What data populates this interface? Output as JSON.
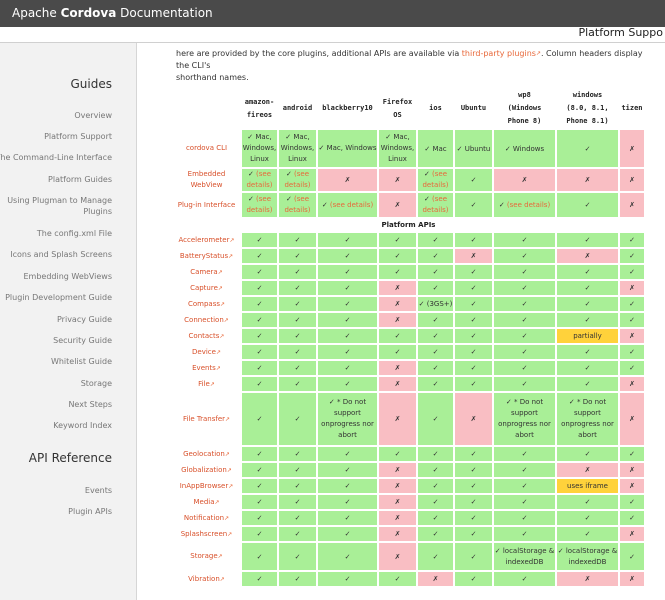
{
  "app": {
    "title_prefix": "Apache ",
    "title_bold": "Cordova",
    "title_suffix": " Documentation",
    "page_title": "Platform Suppo"
  },
  "intro": {
    "pre": "here are provided by the core plugins, additional APIs are available via ",
    "link": "third-party plugins",
    "post": ". Column headers display the CLI's",
    "line2": "shorthand names."
  },
  "sidebar": {
    "guides_heading": "Guides",
    "guides": [
      "Overview",
      "Platform Support",
      "The Command-Line Interface",
      "Platform Guides",
      "Using Plugman to Manage Plugins",
      "The config.xml File",
      "Icons and Splash Screens",
      "Embedding WebViews",
      "Plugin Development Guide",
      "Privacy Guide",
      "Security Guide",
      "Whitelist Guide",
      "Storage",
      "Next Steps",
      "Keyword Index"
    ],
    "api_heading": "API Reference",
    "api": [
      "Events",
      "Plugin APIs"
    ]
  },
  "table": {
    "headers": [
      "amazon-fireos",
      "android",
      "blackberry10",
      "Firefox OS",
      "ios",
      "Ubuntu",
      "wp8 (Windows Phone 8)",
      "windows (8.0, 8.1, Phone 8.1)",
      "tizen"
    ],
    "section_label": "Platform APIs",
    "rows": [
      {
        "label": "cordova CLI",
        "cells": [
          [
            "g",
            "✓ Mac, Windows, Linux"
          ],
          [
            "g",
            "✓ Mac, Windows, Linux"
          ],
          [
            "g",
            "✓ Mac, Windows"
          ],
          [
            "g",
            "✓ Mac, Windows, Linux"
          ],
          [
            "g",
            "✓ Mac"
          ],
          [
            "g",
            "✓ Ubuntu"
          ],
          [
            "g",
            "✓ Windows"
          ],
          [
            "g",
            "✓"
          ],
          [
            "r",
            "✗"
          ]
        ]
      },
      {
        "label": "Embedded WebView",
        "cells": [
          [
            "g",
            "✓ (see details)"
          ],
          [
            "g",
            "✓ (see details)"
          ],
          [
            "r",
            "✗"
          ],
          [
            "r",
            "✗"
          ],
          [
            "g",
            "✓ (see details)"
          ],
          [
            "g",
            "✓"
          ],
          [
            "r",
            "✗"
          ],
          [
            "r",
            "✗"
          ],
          [
            "r",
            "✗"
          ]
        ]
      },
      {
        "label": "Plug-in Interface",
        "cells": [
          [
            "g",
            "✓ (see details)"
          ],
          [
            "g",
            "✓ (see details)"
          ],
          [
            "g",
            "✓ (see details)"
          ],
          [
            "r",
            "✗"
          ],
          [
            "g",
            "✓ (see details)"
          ],
          [
            "g",
            "✓"
          ],
          [
            "g",
            "✓ (see details)"
          ],
          [
            "g",
            "✓"
          ],
          [
            "r",
            "✗"
          ]
        ]
      },
      {
        "label": "Accelerometer",
        "cells": [
          [
            "g",
            "✓"
          ],
          [
            "g",
            "✓"
          ],
          [
            "g",
            "✓"
          ],
          [
            "g",
            "✓"
          ],
          [
            "g",
            "✓"
          ],
          [
            "g",
            "✓"
          ],
          [
            "g",
            "✓"
          ],
          [
            "g",
            "✓"
          ],
          [
            "g",
            "✓"
          ]
        ]
      },
      {
        "label": "BatteryStatus",
        "cells": [
          [
            "g",
            "✓"
          ],
          [
            "g",
            "✓"
          ],
          [
            "g",
            "✓"
          ],
          [
            "g",
            "✓"
          ],
          [
            "g",
            "✓"
          ],
          [
            "r",
            "✗"
          ],
          [
            "g",
            "✓"
          ],
          [
            "r",
            "✗"
          ],
          [
            "g",
            "✓"
          ]
        ]
      },
      {
        "label": "Camera",
        "cells": [
          [
            "g",
            "✓"
          ],
          [
            "g",
            "✓"
          ],
          [
            "g",
            "✓"
          ],
          [
            "g",
            "✓"
          ],
          [
            "g",
            "✓"
          ],
          [
            "g",
            "✓"
          ],
          [
            "g",
            "✓"
          ],
          [
            "g",
            "✓"
          ],
          [
            "g",
            "✓"
          ]
        ]
      },
      {
        "label": "Capture",
        "cells": [
          [
            "g",
            "✓"
          ],
          [
            "g",
            "✓"
          ],
          [
            "g",
            "✓"
          ],
          [
            "r",
            "✗"
          ],
          [
            "g",
            "✓"
          ],
          [
            "g",
            "✓"
          ],
          [
            "g",
            "✓"
          ],
          [
            "g",
            "✓"
          ],
          [
            "r",
            "✗"
          ]
        ]
      },
      {
        "label": "Compass",
        "cells": [
          [
            "g",
            "✓"
          ],
          [
            "g",
            "✓"
          ],
          [
            "g",
            "✓"
          ],
          [
            "r",
            "✗"
          ],
          [
            "g",
            "✓ (3GS+)"
          ],
          [
            "g",
            "✓"
          ],
          [
            "g",
            "✓"
          ],
          [
            "g",
            "✓"
          ],
          [
            "g",
            "✓"
          ]
        ]
      },
      {
        "label": "Connection",
        "cells": [
          [
            "g",
            "✓"
          ],
          [
            "g",
            "✓"
          ],
          [
            "g",
            "✓"
          ],
          [
            "r",
            "✗"
          ],
          [
            "g",
            "✓"
          ],
          [
            "g",
            "✓"
          ],
          [
            "g",
            "✓"
          ],
          [
            "g",
            "✓"
          ],
          [
            "g",
            "✓"
          ]
        ]
      },
      {
        "label": "Contacts",
        "cells": [
          [
            "g",
            "✓"
          ],
          [
            "g",
            "✓"
          ],
          [
            "g",
            "✓"
          ],
          [
            "g",
            "✓"
          ],
          [
            "g",
            "✓"
          ],
          [
            "g",
            "✓"
          ],
          [
            "g",
            "✓"
          ],
          [
            "y",
            "partially"
          ],
          [
            "r",
            "✗"
          ]
        ]
      },
      {
        "label": "Device",
        "cells": [
          [
            "g",
            "✓"
          ],
          [
            "g",
            "✓"
          ],
          [
            "g",
            "✓"
          ],
          [
            "g",
            "✓"
          ],
          [
            "g",
            "✓"
          ],
          [
            "g",
            "✓"
          ],
          [
            "g",
            "✓"
          ],
          [
            "g",
            "✓"
          ],
          [
            "g",
            "✓"
          ]
        ]
      },
      {
        "label": "Events",
        "cells": [
          [
            "g",
            "✓"
          ],
          [
            "g",
            "✓"
          ],
          [
            "g",
            "✓"
          ],
          [
            "r",
            "✗"
          ],
          [
            "g",
            "✓"
          ],
          [
            "g",
            "✓"
          ],
          [
            "g",
            "✓"
          ],
          [
            "g",
            "✓"
          ],
          [
            "g",
            "✓"
          ]
        ]
      },
      {
        "label": "File",
        "cells": [
          [
            "g",
            "✓"
          ],
          [
            "g",
            "✓"
          ],
          [
            "g",
            "✓"
          ],
          [
            "r",
            "✗"
          ],
          [
            "g",
            "✓"
          ],
          [
            "g",
            "✓"
          ],
          [
            "g",
            "✓"
          ],
          [
            "g",
            "✓"
          ],
          [
            "r",
            "✗"
          ]
        ]
      },
      {
        "label": "File Transfer",
        "cells": [
          [
            "g",
            "✓"
          ],
          [
            "g",
            "✓"
          ],
          [
            "g",
            "✓ * Do not support onprogress nor abort"
          ],
          [
            "r",
            "✗"
          ],
          [
            "g",
            "✓"
          ],
          [
            "r",
            "✗"
          ],
          [
            "g",
            "✓ * Do not support onprogress nor abort"
          ],
          [
            "g",
            "✓ * Do not support onprogress nor abort"
          ],
          [
            "r",
            "✗"
          ]
        ]
      },
      {
        "label": "Geolocation",
        "cells": [
          [
            "g",
            "✓"
          ],
          [
            "g",
            "✓"
          ],
          [
            "g",
            "✓"
          ],
          [
            "g",
            "✓"
          ],
          [
            "g",
            "✓"
          ],
          [
            "g",
            "✓"
          ],
          [
            "g",
            "✓"
          ],
          [
            "g",
            "✓"
          ],
          [
            "g",
            "✓"
          ]
        ]
      },
      {
        "label": "Globalization",
        "cells": [
          [
            "g",
            "✓"
          ],
          [
            "g",
            "✓"
          ],
          [
            "g",
            "✓"
          ],
          [
            "r",
            "✗"
          ],
          [
            "g",
            "✓"
          ],
          [
            "g",
            "✓"
          ],
          [
            "g",
            "✓"
          ],
          [
            "r",
            "✗"
          ],
          [
            "r",
            "✗"
          ]
        ]
      },
      {
        "label": "InAppBrowser",
        "cells": [
          [
            "g",
            "✓"
          ],
          [
            "g",
            "✓"
          ],
          [
            "g",
            "✓"
          ],
          [
            "r",
            "✗"
          ],
          [
            "g",
            "✓"
          ],
          [
            "g",
            "✓"
          ],
          [
            "g",
            "✓"
          ],
          [
            "y",
            "uses iframe"
          ],
          [
            "r",
            "✗"
          ]
        ]
      },
      {
        "label": "Media",
        "cells": [
          [
            "g",
            "✓"
          ],
          [
            "g",
            "✓"
          ],
          [
            "g",
            "✓"
          ],
          [
            "r",
            "✗"
          ],
          [
            "g",
            "✓"
          ],
          [
            "g",
            "✓"
          ],
          [
            "g",
            "✓"
          ],
          [
            "g",
            "✓"
          ],
          [
            "g",
            "✓"
          ]
        ]
      },
      {
        "label": "Notification",
        "cells": [
          [
            "g",
            "✓"
          ],
          [
            "g",
            "✓"
          ],
          [
            "g",
            "✓"
          ],
          [
            "r",
            "✗"
          ],
          [
            "g",
            "✓"
          ],
          [
            "g",
            "✓"
          ],
          [
            "g",
            "✓"
          ],
          [
            "g",
            "✓"
          ],
          [
            "g",
            "✓"
          ]
        ]
      },
      {
        "label": "Splashscreen",
        "cells": [
          [
            "g",
            "✓"
          ],
          [
            "g",
            "✓"
          ],
          [
            "g",
            "✓"
          ],
          [
            "r",
            "✗"
          ],
          [
            "g",
            "✓"
          ],
          [
            "g",
            "✓"
          ],
          [
            "g",
            "✓"
          ],
          [
            "g",
            "✓"
          ],
          [
            "r",
            "✗"
          ]
        ]
      },
      {
        "label": "Storage",
        "cells": [
          [
            "g",
            "✓"
          ],
          [
            "g",
            "✓"
          ],
          [
            "g",
            "✓"
          ],
          [
            "r",
            "✗"
          ],
          [
            "g",
            "✓"
          ],
          [
            "g",
            "✓"
          ],
          [
            "g",
            "✓ localStorage & indexedDB"
          ],
          [
            "g",
            "✓ localStorage & indexedDB"
          ],
          [
            "g",
            "✓"
          ]
        ]
      },
      {
        "label": "Vibration",
        "cells": [
          [
            "g",
            "✓"
          ],
          [
            "g",
            "✓"
          ],
          [
            "g",
            "✓"
          ],
          [
            "g",
            "✓"
          ],
          [
            "r",
            "✗"
          ],
          [
            "g",
            "✓"
          ],
          [
            "g",
            "✓"
          ],
          [
            "r",
            "✗"
          ],
          [
            "r",
            "✗"
          ]
        ]
      }
    ]
  },
  "colors": {
    "supported": "#a9ef97",
    "unsupported": "#f9bec3",
    "partial": "#ffd23b",
    "link": "#e8683a",
    "topbar": "#4a4a4a"
  }
}
